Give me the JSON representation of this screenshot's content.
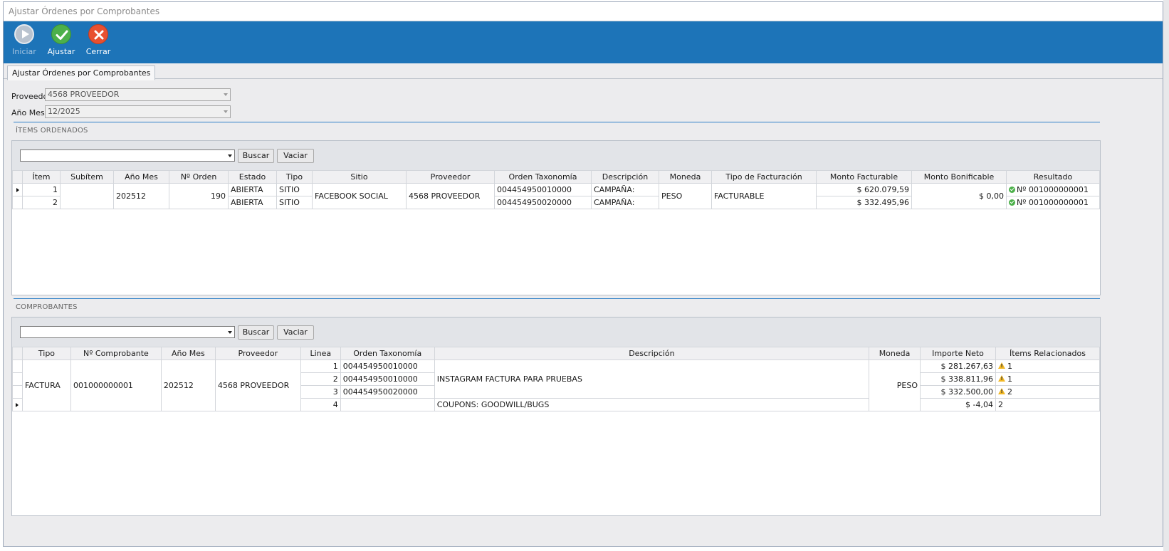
{
  "window": {
    "title": "Ajustar Órdenes por Comprobantes"
  },
  "toolbar": {
    "iniciar_label": "Iniciar",
    "ajustar_label": "Ajustar",
    "cerrar_label": "Cerrar"
  },
  "tab": {
    "label": "Ajustar Órdenes por Comprobantes"
  },
  "form": {
    "proveedor_label": "Proveedor",
    "proveedor_value": "4568 PROVEEDOR",
    "anio_mes_label": "Año Mes",
    "anio_mes_value": "12/2025"
  },
  "items": {
    "section_title": "ÍTEMS ORDENADOS",
    "buscar_label": "Buscar",
    "vaciar_label": "Vaciar",
    "columns": [
      "Ítem",
      "Subítem",
      "Año Mes",
      "Nº Orden",
      "Estado",
      "Tipo",
      "Sitio",
      "Proveedor",
      "Orden Taxonomía",
      "Descripción",
      "Moneda",
      "Tipo de Facturación",
      "Monto Facturable",
      "Monto Bonificable",
      "Resultado"
    ],
    "shared": {
      "anio_mes": "202512",
      "nro_orden": "190",
      "sitio": "FACEBOOK SOCIAL",
      "proveedor": "4568 PROVEEDOR",
      "moneda": "PESO",
      "tipo_facturacion": "FACTURABLE",
      "monto_bonificable": "$ 0,00"
    },
    "rows": [
      {
        "item": "1",
        "estado": "ABIERTA",
        "tipo": "SITIO",
        "orden_taxonomia": "004454950010000",
        "descripcion": "CAMPAÑA:",
        "monto_facturable": "$ 620.079,59",
        "resultado": "Nº 001000000001"
      },
      {
        "item": "2",
        "estado": "ABIERTA",
        "tipo": "SITIO",
        "orden_taxonomia": "004454950020000",
        "descripcion": "CAMPAÑA:",
        "monto_facturable": "$ 332.495,96",
        "resultado": "Nº 001000000001"
      }
    ]
  },
  "comprobantes": {
    "section_title": "COMPROBANTES",
    "buscar_label": "Buscar",
    "vaciar_label": "Vaciar",
    "columns": [
      "Tipo",
      "Nº Comprobante",
      "Año Mes",
      "Proveedor",
      "Linea",
      "Orden Taxonomía",
      "Descripción",
      "Moneda",
      "Importe Neto",
      "Ítems Relacionados"
    ],
    "shared": {
      "tipo": "FACTURA",
      "nro_comprobante": "001000000001",
      "anio_mes": "202512",
      "proveedor": "4568 PROVEEDOR",
      "moneda": "PESO",
      "descripcion_grupo": "INSTAGRAM FACTURA PARA PRUEBAS"
    },
    "rows": [
      {
        "linea": "1",
        "orden_taxonomia": "004454950010000",
        "importe_neto": "$ 281.267,63",
        "items_relacionados": "1",
        "warning": true
      },
      {
        "linea": "2",
        "orden_taxonomia": "004454950010000",
        "importe_neto": "$ 338.811,96",
        "items_relacionados": "1",
        "warning": true
      },
      {
        "linea": "3",
        "orden_taxonomia": "004454950020000",
        "importe_neto": "$ 332.500,00",
        "items_relacionados": "2",
        "warning": true
      },
      {
        "linea": "4",
        "orden_taxonomia": "",
        "descripcion": "COUPONS: GOODWILL/BUGS",
        "importe_neto": "$ -4,04",
        "items_relacionados": "2",
        "warning": false
      }
    ]
  },
  "colors": {
    "ribbon": "#1d74b8",
    "section_line": "#2f80c8",
    "ok": "#4cb04a",
    "warning": "#f2b824",
    "close": "#e85030"
  },
  "icons": {
    "iniciar": "play-circle-icon",
    "ajustar": "check-circle-icon",
    "cerrar": "close-circle-icon",
    "resultado": "ok-check-icon",
    "items_relacionados": "warning-triangle-icon"
  }
}
